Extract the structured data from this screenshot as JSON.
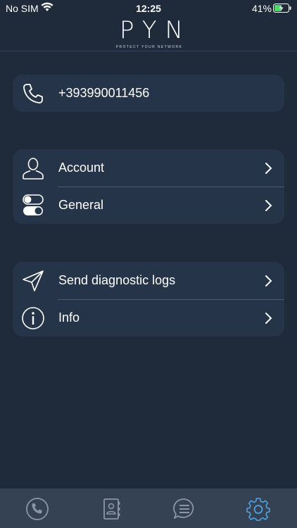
{
  "status": {
    "carrier": "No SIM",
    "time": "12:25",
    "battery": "41%"
  },
  "header": {
    "logo": "PYN",
    "tagline": "PROTECT YOUR NETWORK"
  },
  "phone": {
    "number": "+393990011456",
    "icon": "phone-icon"
  },
  "settings_group": [
    {
      "label": "Account",
      "icon": "user-icon"
    },
    {
      "label": "General",
      "icon": "toggles-icon"
    }
  ],
  "support_group": [
    {
      "label": "Send diagnostic logs",
      "icon": "send-icon"
    },
    {
      "label": "Info",
      "icon": "info-icon"
    }
  ],
  "tabs": [
    {
      "name": "calls",
      "icon": "phone-icon",
      "active": false
    },
    {
      "name": "contacts",
      "icon": "contacts-book-icon",
      "active": false
    },
    {
      "name": "messages",
      "icon": "chat-icon",
      "active": false
    },
    {
      "name": "settings",
      "icon": "gear-icon",
      "active": true
    }
  ],
  "colors": {
    "background": "#1f2b3b",
    "card": "#26344a",
    "tabbar": "#344253",
    "active_tab": "#4fa3e0",
    "inactive_tab": "#8a96a6"
  }
}
